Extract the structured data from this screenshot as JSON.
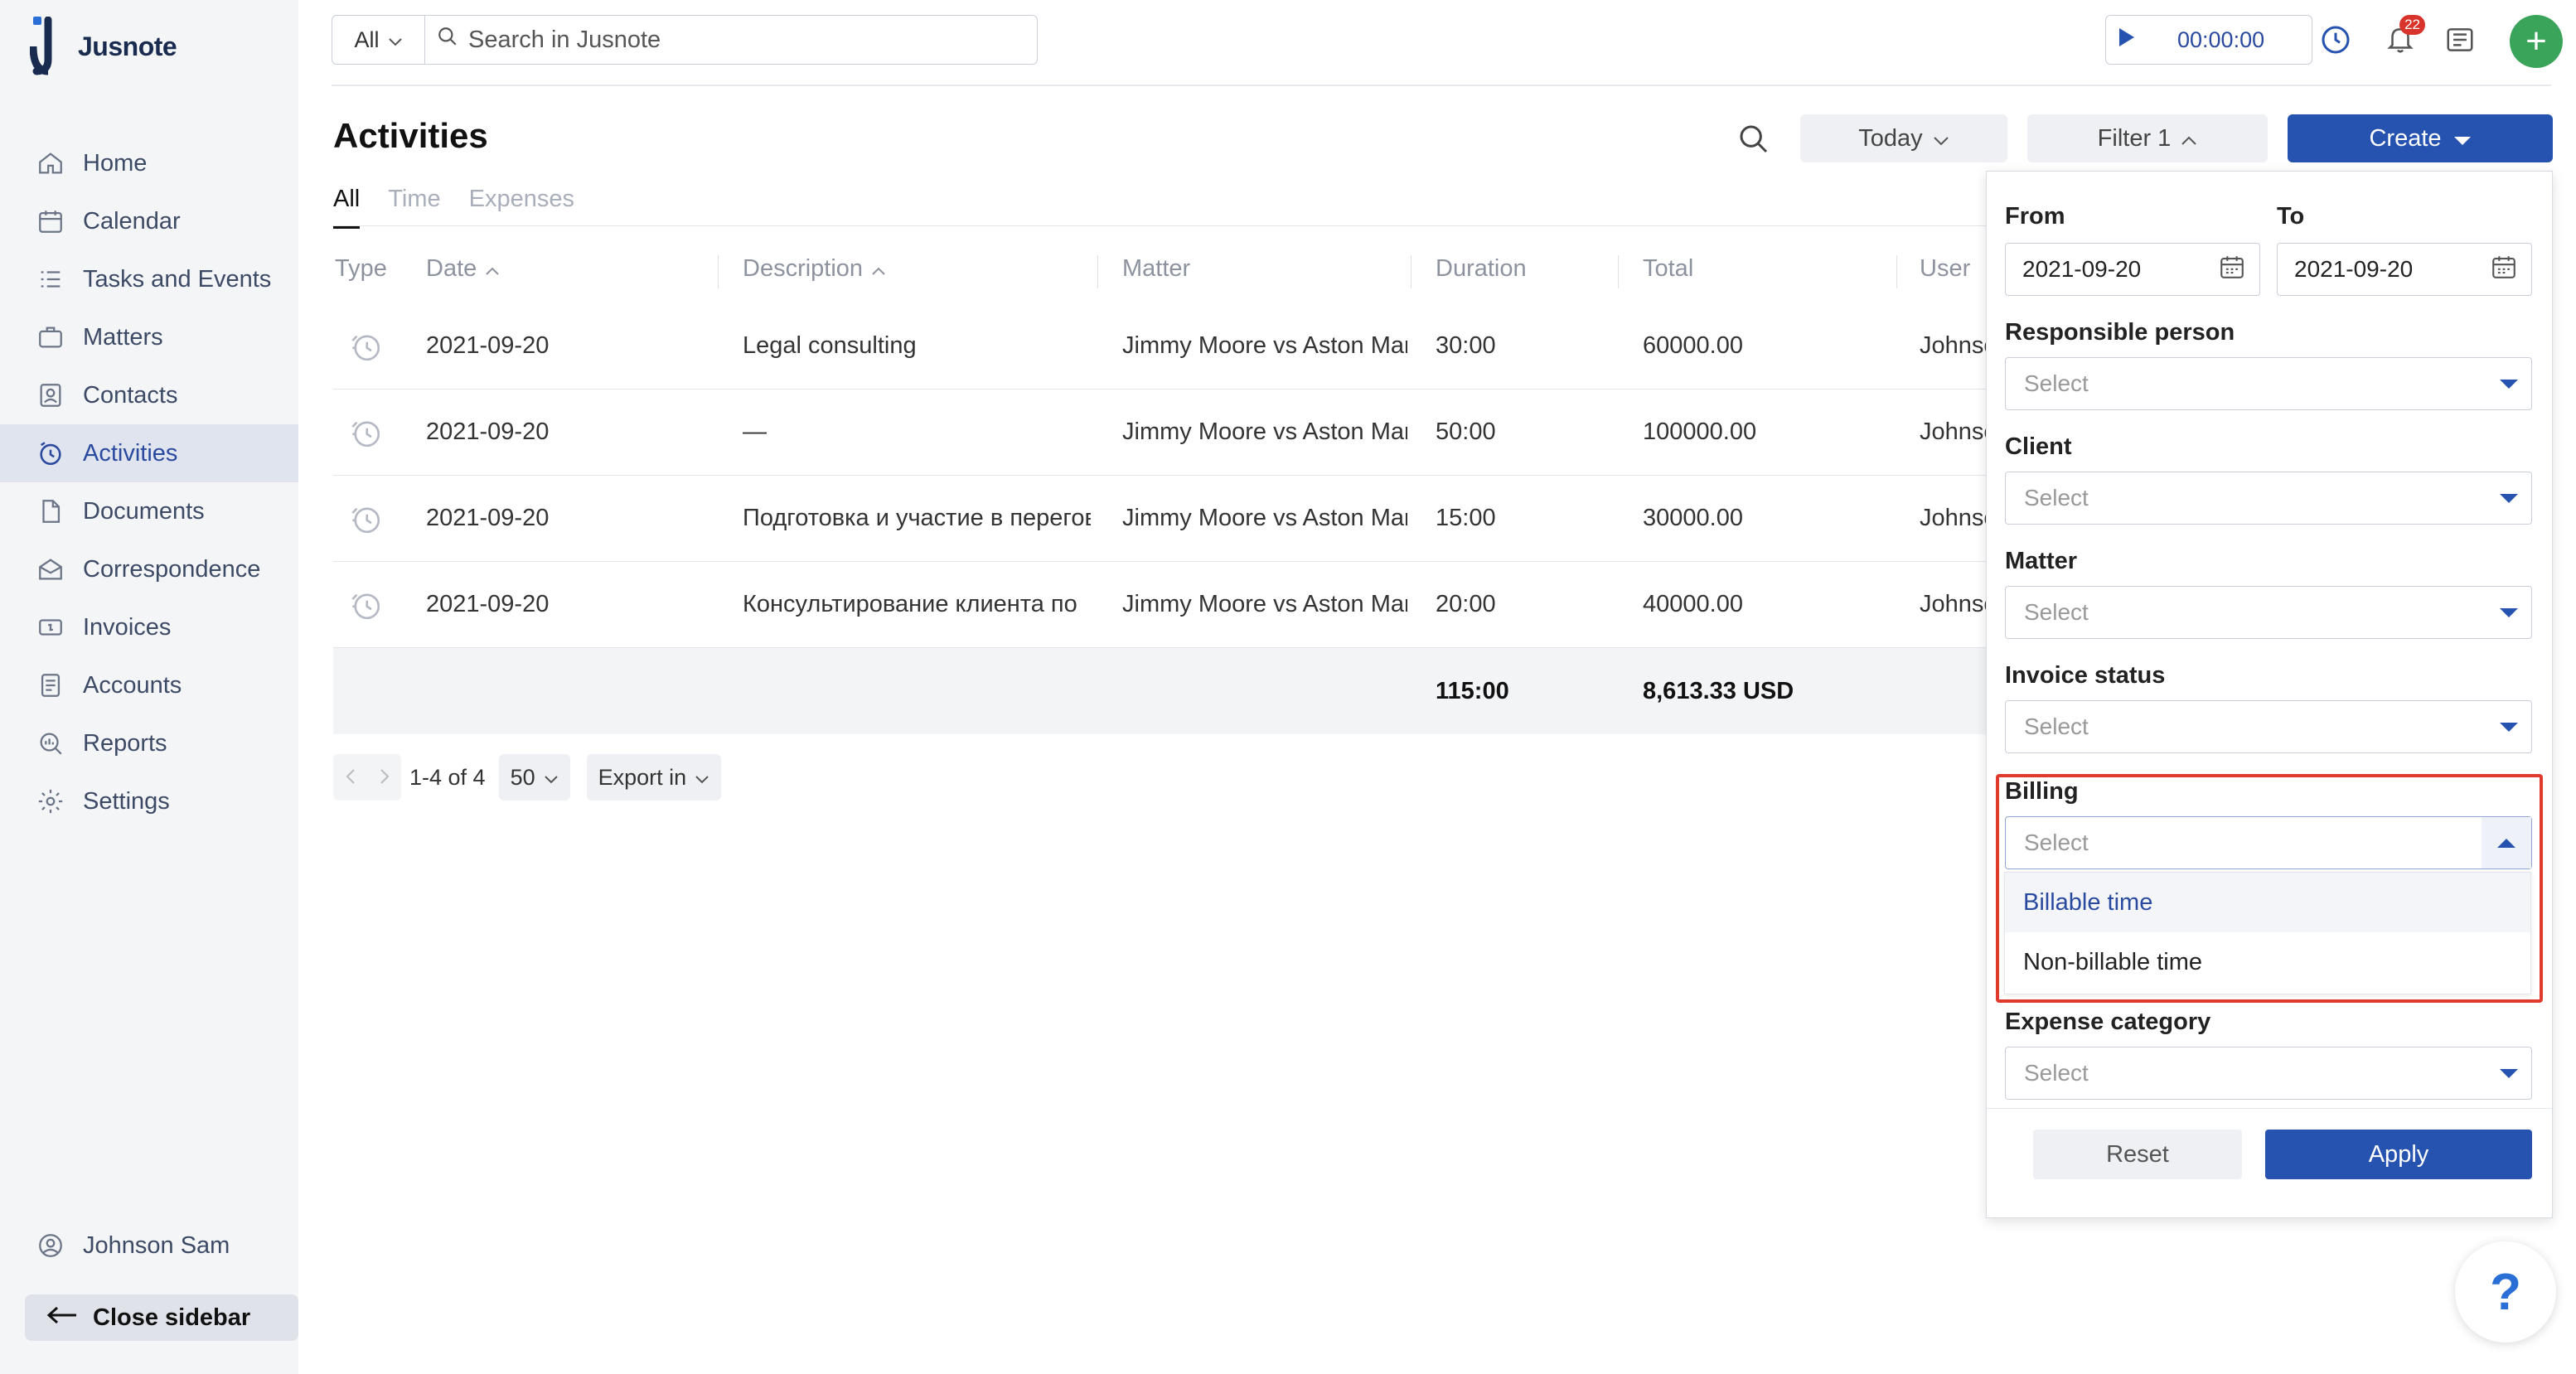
{
  "app": {
    "name": "Jusnote"
  },
  "sidebar": {
    "items": [
      {
        "label": "Home",
        "icon": "home-icon"
      },
      {
        "label": "Calendar",
        "icon": "calendar-icon"
      },
      {
        "label": "Tasks and Events",
        "icon": "tasks-icon"
      },
      {
        "label": "Matters",
        "icon": "briefcase-icon"
      },
      {
        "label": "Contacts",
        "icon": "contacts-icon"
      },
      {
        "label": "Activities",
        "icon": "activities-icon",
        "active": true
      },
      {
        "label": "Documents",
        "icon": "documents-icon"
      },
      {
        "label": "Correspondence",
        "icon": "correspondence-icon"
      },
      {
        "label": "Invoices",
        "icon": "invoices-icon"
      },
      {
        "label": "Accounts",
        "icon": "accounts-icon"
      },
      {
        "label": "Reports",
        "icon": "reports-icon"
      },
      {
        "label": "Settings",
        "icon": "gear-icon"
      }
    ],
    "user": "Johnson Sam",
    "close_label": "Close sidebar"
  },
  "topbar": {
    "scope": "All",
    "search_placeholder": "Search in Jusnote",
    "timer": "00:00:00",
    "notifications_count": "22"
  },
  "page": {
    "title": "Activities",
    "today_label": "Today",
    "filter_label": "Filter 1",
    "create_label": "Create",
    "tabs": [
      "All",
      "Time",
      "Expenses"
    ]
  },
  "table": {
    "headers": {
      "type": "Type",
      "date": "Date",
      "description": "Description",
      "matter": "Matter",
      "duration": "Duration",
      "total": "Total",
      "user": "User"
    },
    "rows": [
      {
        "date": "2021-09-20",
        "description": "Legal consulting",
        "matter": "Jimmy Moore vs Aston Martin",
        "duration": "30:00",
        "total": "60000.00",
        "user": "Johnson Sam"
      },
      {
        "date": "2021-09-20",
        "description": "—",
        "matter": "Jimmy Moore vs Aston Martin",
        "duration": "50:00",
        "total": "100000.00",
        "user": "Johnson Sam"
      },
      {
        "date": "2021-09-20",
        "description": "Подготовка и участие в переговорах",
        "matter": "Jimmy Moore vs Aston Martin",
        "duration": "15:00",
        "total": "30000.00",
        "user": "Johnson Sam"
      },
      {
        "date": "2021-09-20",
        "description": "Консультирование клиента по",
        "matter": "Jimmy Moore vs Aston Martin",
        "duration": "20:00",
        "total": "40000.00",
        "user": "Johnson Sam"
      }
    ],
    "totals": {
      "duration": "115:00",
      "total": "8,613.33 USD"
    }
  },
  "pager": {
    "range": "1-4 of 4",
    "page_size": "50",
    "export_label": "Export in"
  },
  "filter": {
    "from_label": "From",
    "to_label": "To",
    "from_value": "2021-09-20",
    "to_value": "2021-09-20",
    "responsible_label": "Responsible person",
    "client_label": "Client",
    "matter_label": "Matter",
    "invoice_status_label": "Invoice status",
    "billing_label": "Billing",
    "expense_category_label": "Expense category",
    "select_placeholder": "Select",
    "billing_options": [
      "Billable time",
      "Non-billable time"
    ],
    "reset_label": "Reset",
    "apply_label": "Apply"
  },
  "help": {
    "label": "?"
  },
  "colors": {
    "accent": "#2753b0",
    "highlight": "#e03a2c",
    "success": "#3aa55a"
  }
}
